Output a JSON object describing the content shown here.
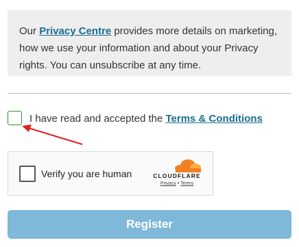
{
  "info": {
    "prefix": "Our ",
    "link": "Privacy Centre",
    "suffix": " provides more details on marketing, how we use your information and about your Privacy rights. You can unsubscribe at any time."
  },
  "consent": {
    "label": "I have read and accepted the ",
    "link": "Terms & Conditions",
    "checked": false
  },
  "annotation": {
    "icon": "red-arrow-icon",
    "color": "#e02020"
  },
  "captcha": {
    "label": "Verify you are human",
    "brand": "CLOUDFLARE",
    "privacy": "Privacy",
    "separator": "•",
    "terms": "Terms",
    "brand_color": "#f38020"
  },
  "register": {
    "label": "Register",
    "color": "#7fb8d9"
  }
}
